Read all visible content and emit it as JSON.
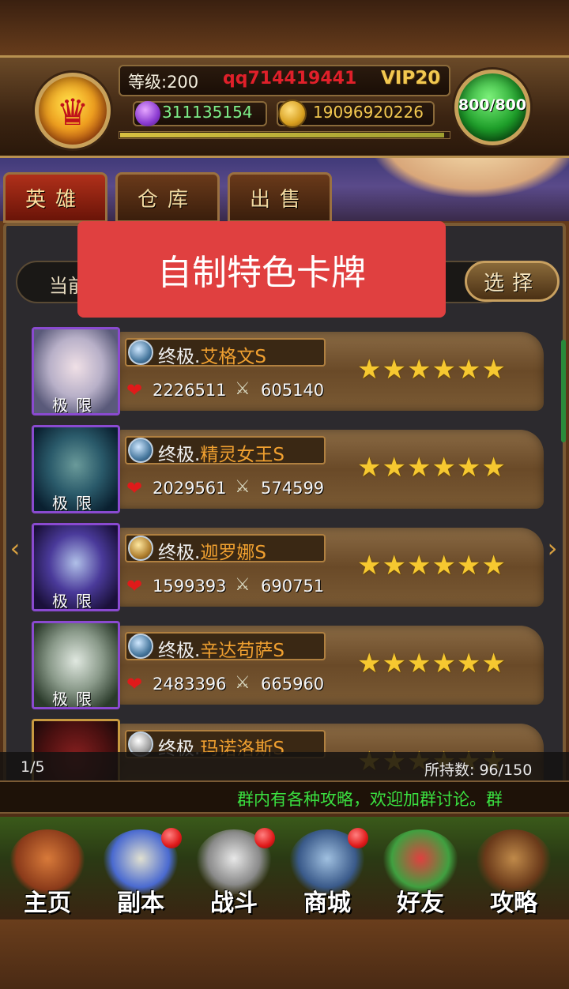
{
  "header": {
    "level": "等级:200",
    "player_name": "qq714419441",
    "vip": "VIP20",
    "gems": "311135154",
    "coins": "19096920226",
    "stamina": "800/800"
  },
  "tabs": [
    {
      "label": "英雄"
    },
    {
      "label": "仓库"
    },
    {
      "label": "出售"
    }
  ],
  "filter": {
    "current_label": "当前",
    "select_label": "选择"
  },
  "banner": {
    "text": "自制特色卡牌"
  },
  "heroes": [
    {
      "prefix": "终极.",
      "name": "艾格文S",
      "hp": "2226511",
      "attack": "605140",
      "tag": "极限",
      "stars": "★★★★★★",
      "element": "water"
    },
    {
      "prefix": "终极.",
      "name": "精灵女王S",
      "hp": "2029561",
      "attack": "574599",
      "tag": "极限",
      "stars": "★★★★★★",
      "element": "water"
    },
    {
      "prefix": "终极.",
      "name": "迦罗娜S",
      "hp": "1599393",
      "attack": "690751",
      "tag": "极限",
      "stars": "★★★★★★",
      "element": "gold"
    },
    {
      "prefix": "终极.",
      "name": "辛达苟萨S",
      "hp": "2483396",
      "attack": "665960",
      "tag": "极限",
      "stars": "★★★★★★",
      "element": "water"
    },
    {
      "prefix": "终极.",
      "name": "玛诺洛斯S",
      "hp": "",
      "attack": "",
      "tag": "",
      "stars": "★★★★★★",
      "element": "silver"
    }
  ],
  "pagination": {
    "page": "1/5",
    "holding": "所持数: 96/150"
  },
  "ticker": {
    "text": "群内有各种攻略，欢迎加群讨论。群"
  },
  "nav": [
    {
      "label": "主页",
      "icon": "home-hut-icon",
      "badge": false
    },
    {
      "label": "副本",
      "icon": "skull-dungeon-icon",
      "badge": true
    },
    {
      "label": "战斗",
      "icon": "sword-axe-icon",
      "badge": true
    },
    {
      "label": "商城",
      "icon": "owl-shop-icon",
      "badge": true
    },
    {
      "label": "好友",
      "icon": "goblin-friends-icon",
      "badge": false
    },
    {
      "label": "攻略",
      "icon": "book-guide-icon",
      "badge": false
    }
  ],
  "colors": {
    "accent_red": "#e04040",
    "ticker_green": "#3ae040",
    "name_orange": "#f0a030",
    "star_gold": "#f6c830"
  }
}
